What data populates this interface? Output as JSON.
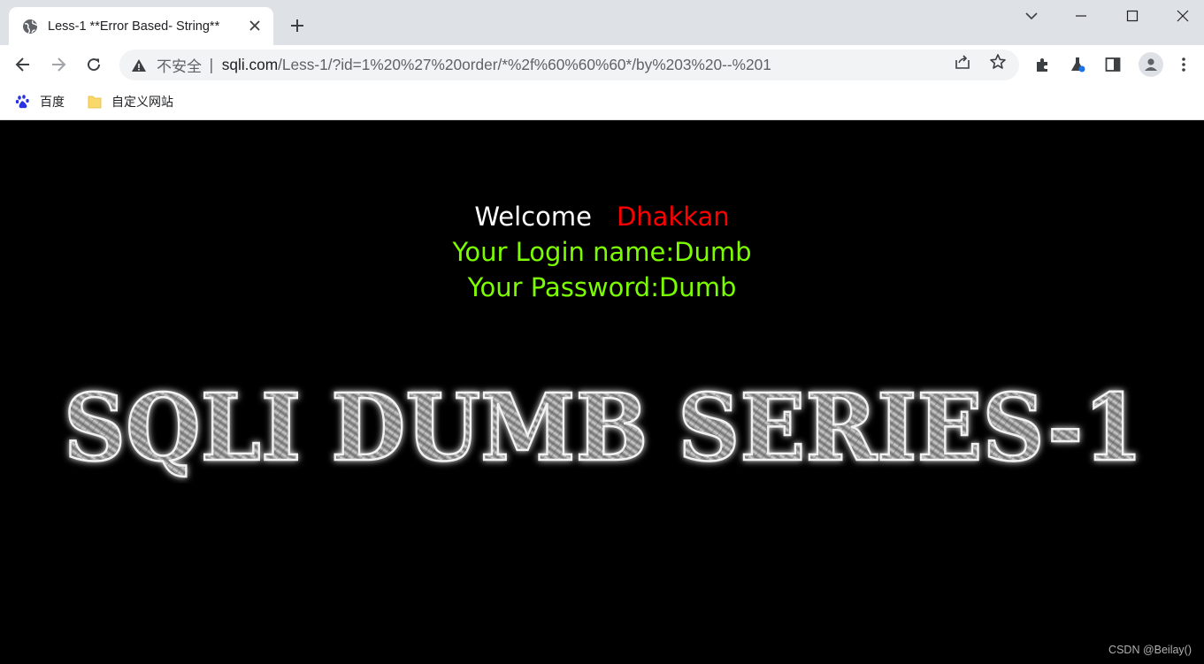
{
  "browser": {
    "tab": {
      "title": "Less-1 **Error Based- String**"
    },
    "address_bar": {
      "security_label": "不安全",
      "url_host": "sqli.com",
      "url_path": "/Less-1/?id=1%20%27%20order/*%2f%60%60%60*/by%203%20--%201"
    },
    "bookmarks": [
      {
        "label": "百度",
        "icon": "baidu-paw-icon"
      },
      {
        "label": "自定义网站",
        "icon": "folder-icon"
      }
    ]
  },
  "page": {
    "welcome_label": "Welcome",
    "username": "Dhakkan",
    "login_line": "Your Login name:Dumb",
    "password_line": "Your Password:Dumb",
    "banner_text": "SQLI DUMB SERIES-1"
  },
  "watermark": "CSDN @Beilay()",
  "colors": {
    "page_bg": "#000000",
    "welcome": "#ffffff",
    "username": "#ff0000",
    "info": "#7cfc00",
    "tabstrip": "#dee1e6"
  }
}
